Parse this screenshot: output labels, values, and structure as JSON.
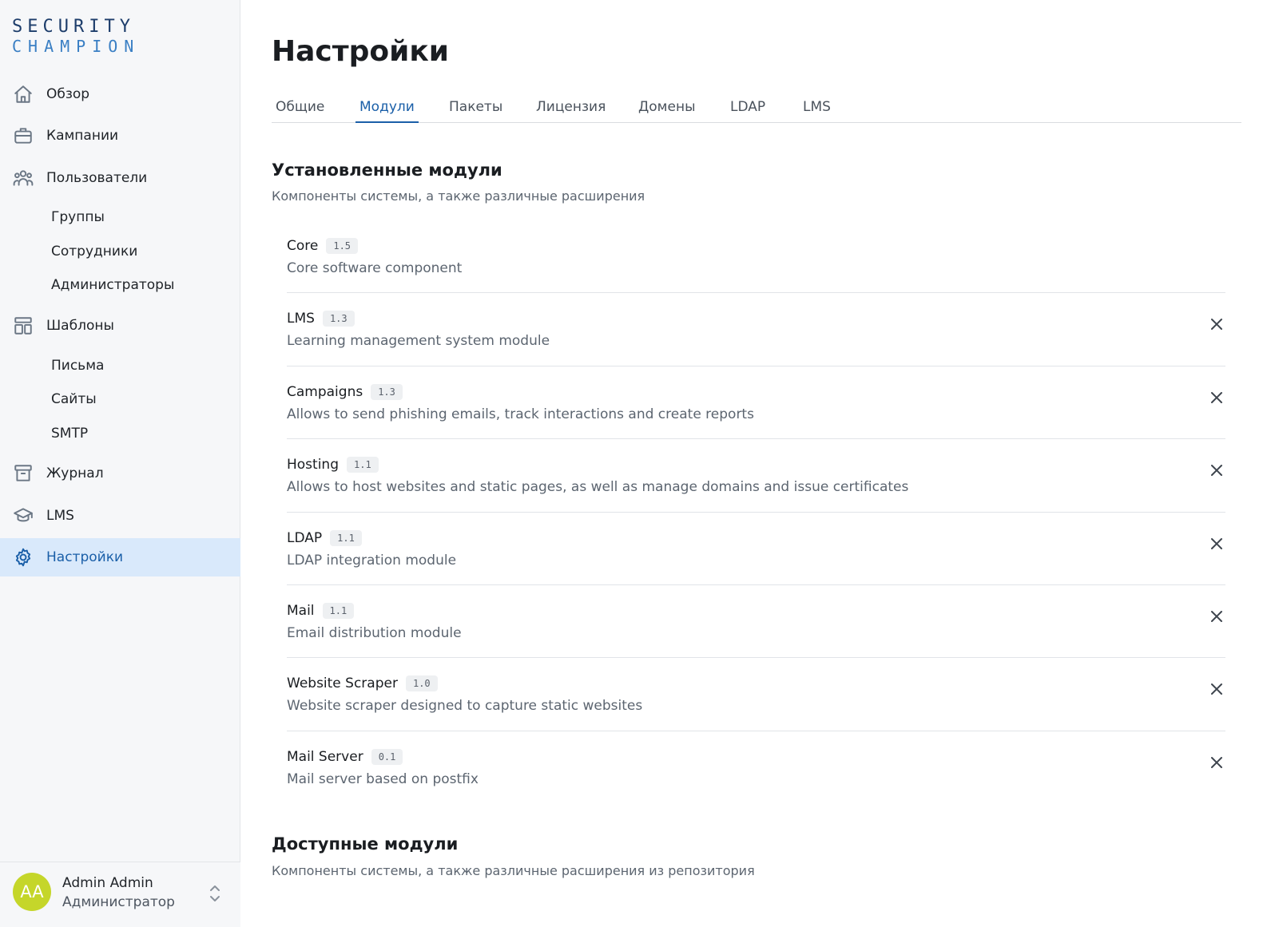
{
  "logo": {
    "line1": "SECURITY",
    "line2": "CHAMPION"
  },
  "sidebar": {
    "items": [
      {
        "label": "Обзор",
        "icon": "home-icon"
      },
      {
        "label": "Кампании",
        "icon": "briefcase-icon"
      },
      {
        "label": "Пользователи",
        "icon": "users-icon"
      },
      {
        "label": "Шаблоны",
        "icon": "templates-icon"
      },
      {
        "label": "Журнал",
        "icon": "archive-icon"
      },
      {
        "label": "LMS",
        "icon": "graduation-cap-icon"
      },
      {
        "label": "Настройки",
        "icon": "gear-icon",
        "active": true
      }
    ],
    "users_sub": [
      "Группы",
      "Сотрудники",
      "Администраторы"
    ],
    "templates_sub": [
      "Письма",
      "Сайты",
      "SMTP"
    ]
  },
  "user": {
    "initials": "AA",
    "name": "Admin Admin",
    "role": "Администратор",
    "avatar_color": "#c5d62a"
  },
  "main": {
    "title": "Настройки",
    "tabs": [
      "Общие",
      "Модули",
      "Пакеты",
      "Лицензия",
      "Домены",
      "LDAP",
      "LMS"
    ],
    "active_tab": "Модули",
    "installed": {
      "title": "Установленные модули",
      "subtitle": "Компоненты системы, а также различные расширения",
      "modules": [
        {
          "name": "Core",
          "version": "1.5",
          "description": "Core software component",
          "removable": false
        },
        {
          "name": "LMS",
          "version": "1.3",
          "description": "Learning management system module",
          "removable": true
        },
        {
          "name": "Campaigns",
          "version": "1.3",
          "description": "Allows to send phishing emails, track interactions and create reports",
          "removable": true
        },
        {
          "name": "Hosting",
          "version": "1.1",
          "description": "Allows to host websites and static pages, as well as manage domains and issue certificates",
          "removable": true
        },
        {
          "name": "LDAP",
          "version": "1.1",
          "description": "LDAP integration module",
          "removable": true
        },
        {
          "name": "Mail",
          "version": "1.1",
          "description": "Email distribution module",
          "removable": true
        },
        {
          "name": "Website Scraper",
          "version": "1.0",
          "description": "Website scraper designed to capture static websites",
          "removable": true
        },
        {
          "name": "Mail Server",
          "version": "0.1",
          "description": "Mail server based on postfix",
          "removable": true
        }
      ]
    },
    "available": {
      "title": "Доступные модули",
      "subtitle": "Компоненты системы, а также различные расширения из репозитория"
    }
  },
  "colors": {
    "accent": "#1a5fa8",
    "active_bg": "#d9e9fb",
    "sidebar_bg": "#f6f7f9"
  }
}
